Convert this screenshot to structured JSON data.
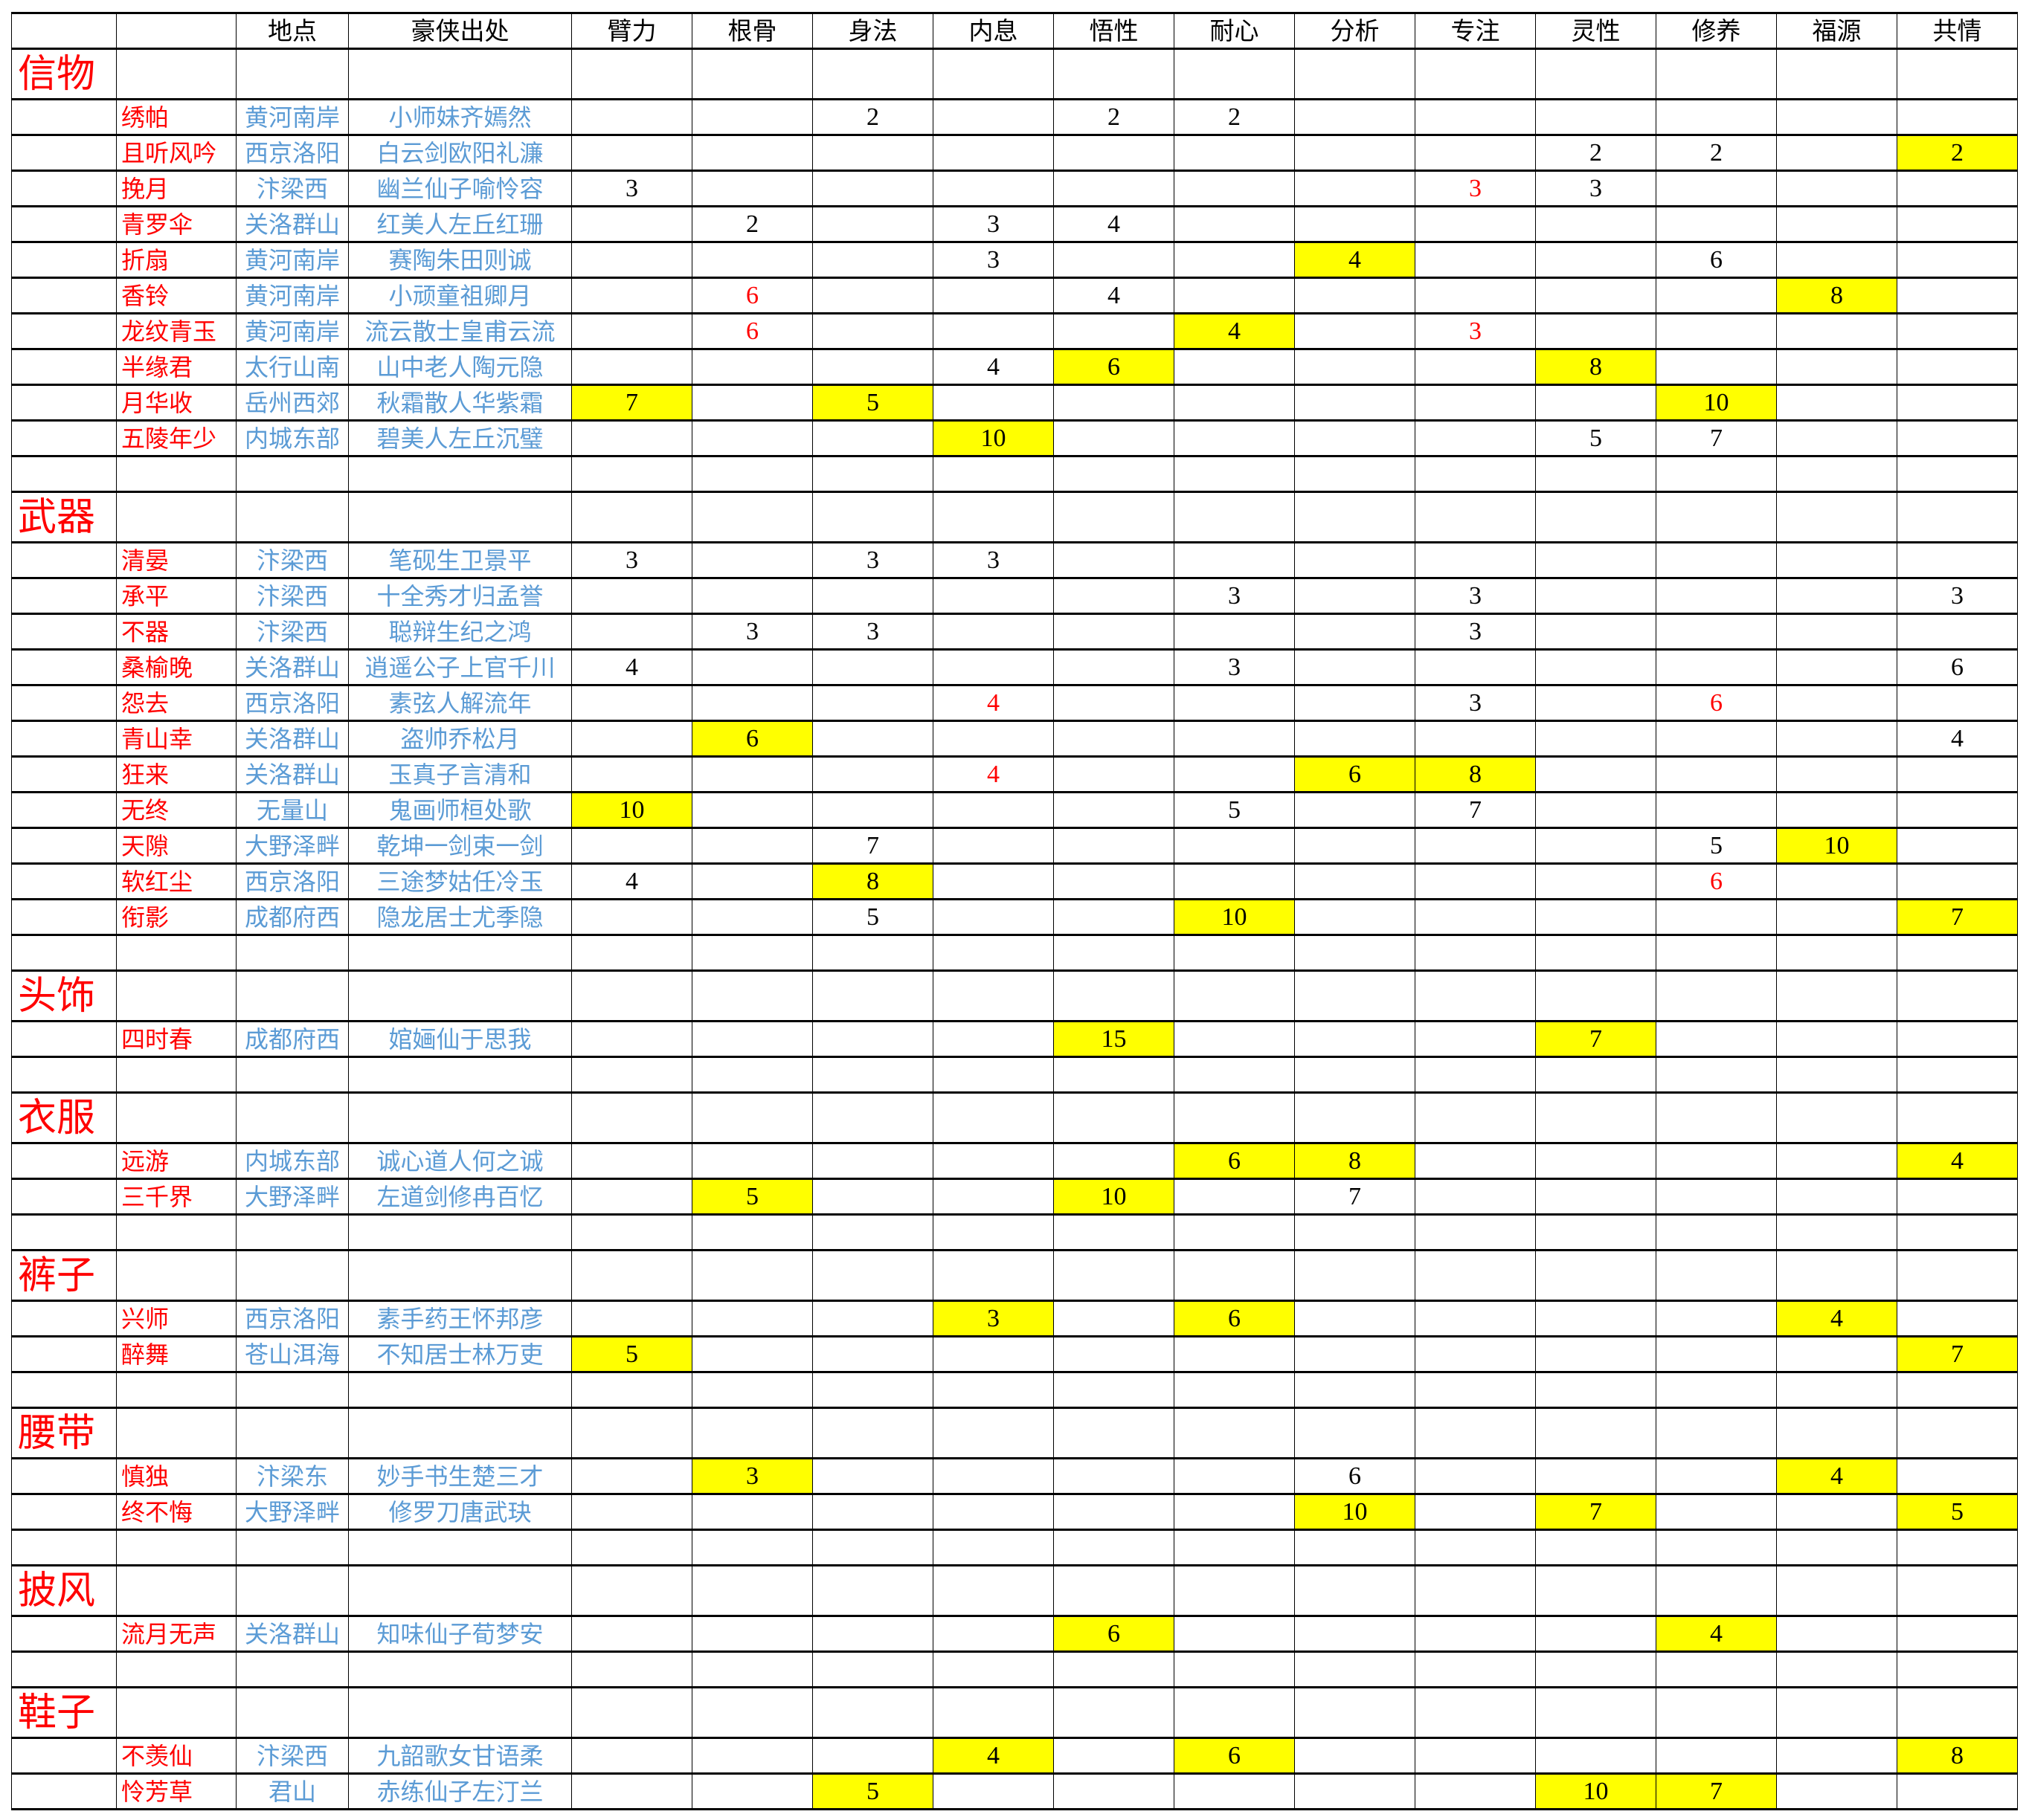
{
  "colors": {
    "item_name": "#ff0000",
    "location": "#5b9bd5",
    "highlight": "#ffff00",
    "red_value": "#ff0000"
  },
  "headers": [
    "",
    "",
    "地点",
    "豪侠出处",
    "臂力",
    "根骨",
    "身法",
    "内息",
    "悟性",
    "耐心",
    "分析",
    "专注",
    "灵性",
    "修养",
    "福源",
    "共情"
  ],
  "sections": [
    {
      "category": "信物",
      "items": [
        {
          "name": "绣帕",
          "location": "黄河南岸",
          "source": "小师妹齐嫣然",
          "stats": {
            "身法": "2",
            "悟性": "2",
            "耐心": "2"
          },
          "highlighted": [],
          "red": []
        },
        {
          "name": "且听风吟",
          "location": "西京洛阳",
          "source": "白云剑欧阳礼濂",
          "stats": {
            "灵性": "2",
            "修养": "2",
            "共情": "2"
          },
          "highlighted": [
            "共情"
          ],
          "red": []
        },
        {
          "name": "挽月",
          "location": "汴梁西",
          "source": "幽兰仙子喻怜容",
          "stats": {
            "臂力": "3",
            "专注": "3",
            "灵性": "3"
          },
          "highlighted": [],
          "red": [
            "专注"
          ]
        },
        {
          "name": "青罗伞",
          "location": "关洛群山",
          "source": "红美人左丘红珊",
          "stats": {
            "根骨": "2",
            "内息": "3",
            "悟性": "4"
          },
          "highlighted": [],
          "red": []
        },
        {
          "name": "折扇",
          "location": "黄河南岸",
          "source": "赛陶朱田则诚",
          "stats": {
            "内息": "3",
            "分析": "4",
            "修养": "6"
          },
          "highlighted": [
            "分析"
          ],
          "red": []
        },
        {
          "name": "香铃",
          "location": "黄河南岸",
          "source": "小顽童祖卿月",
          "stats": {
            "根骨": "6",
            "悟性": "4",
            "福源": "8"
          },
          "highlighted": [
            "福源"
          ],
          "red": [
            "根骨"
          ]
        },
        {
          "name": "龙纹青玉",
          "location": "黄河南岸",
          "source": "流云散士皇甫云流",
          "stats": {
            "根骨": "6",
            "耐心": "4",
            "专注": "3"
          },
          "highlighted": [
            "耐心"
          ],
          "red": [
            "根骨",
            "专注"
          ]
        },
        {
          "name": "半缘君",
          "location": "太行山南",
          "source": "山中老人陶元隐",
          "stats": {
            "内息": "4",
            "悟性": "6",
            "灵性": "8"
          },
          "highlighted": [
            "悟性",
            "灵性"
          ],
          "red": []
        },
        {
          "name": "月华收",
          "location": "岳州西郊",
          "source": "秋霜散人华紫霜",
          "stats": {
            "臂力": "7",
            "身法": "5",
            "修养": "10"
          },
          "highlighted": [
            "臂力",
            "身法",
            "修养"
          ],
          "red": []
        },
        {
          "name": "五陵年少",
          "location": "内城东部",
          "source": "碧美人左丘沉璧",
          "stats": {
            "内息": "10",
            "灵性": "5",
            "修养": "7"
          },
          "highlighted": [
            "内息"
          ],
          "red": []
        }
      ]
    },
    {
      "category": "武器",
      "items": [
        {
          "name": "清晏",
          "location": "汴梁西",
          "source": "笔砚生卫景平",
          "stats": {
            "臂力": "3",
            "身法": "3",
            "内息": "3"
          },
          "highlighted": [],
          "red": []
        },
        {
          "name": "承平",
          "location": "汴梁西",
          "source": "十全秀才归孟誉",
          "stats": {
            "耐心": "3",
            "专注": "3",
            "共情": "3"
          },
          "highlighted": [],
          "red": []
        },
        {
          "name": "不器",
          "location": "汴梁西",
          "source": "聪辩生纪之鸿",
          "stats": {
            "根骨": "3",
            "身法": "3",
            "专注": "3"
          },
          "highlighted": [],
          "red": []
        },
        {
          "name": "桑榆晚",
          "location": "关洛群山",
          "source": "逍遥公子上官千川",
          "stats": {
            "臂力": "4",
            "耐心": "3",
            "共情": "6"
          },
          "highlighted": [],
          "red": []
        },
        {
          "name": "怨去",
          "location": "西京洛阳",
          "source": "素弦人解流年",
          "stats": {
            "内息": "4",
            "专注": "3",
            "修养": "6"
          },
          "highlighted": [],
          "red": [
            "内息",
            "修养"
          ]
        },
        {
          "name": "青山幸",
          "location": "关洛群山",
          "source": "盗帅乔松月",
          "stats": {
            "根骨": "6",
            "共情": "4"
          },
          "highlighted": [
            "根骨"
          ],
          "red": []
        },
        {
          "name": "狂来",
          "location": "关洛群山",
          "source": "玉真子言清和",
          "stats": {
            "内息": "4",
            "分析": "6",
            "专注": "8"
          },
          "highlighted": [
            "分析",
            "专注"
          ],
          "red": [
            "内息"
          ]
        },
        {
          "name": "无终",
          "location": "无量山",
          "source": "鬼画师桓处歌",
          "stats": {
            "臂力": "10",
            "耐心": "5",
            "专注": "7"
          },
          "highlighted": [
            "臂力"
          ],
          "red": []
        },
        {
          "name": "天隙",
          "location": "大野泽畔",
          "source": "乾坤一剑束一剑",
          "stats": {
            "身法": "7",
            "修养": "5",
            "福源": "10"
          },
          "highlighted": [
            "福源"
          ],
          "red": []
        },
        {
          "name": "软红尘",
          "location": "西京洛阳",
          "source": "三途梦姑任冷玉",
          "stats": {
            "臂力": "4",
            "身法": "8",
            "修养": "6"
          },
          "highlighted": [
            "身法"
          ],
          "red": [
            "修养"
          ]
        },
        {
          "name": "衔影",
          "location": "成都府西",
          "source": "隐龙居士尤季隐",
          "stats": {
            "身法": "5",
            "耐心": "10",
            "共情": "7"
          },
          "highlighted": [
            "耐心",
            "共情"
          ],
          "red": []
        }
      ]
    },
    {
      "category": "头饰",
      "items": [
        {
          "name": "四时春",
          "location": "成都府西",
          "source": "婠婳仙于思我",
          "stats": {
            "悟性": "15",
            "灵性": "7"
          },
          "highlighted": [
            "悟性",
            "灵性"
          ],
          "red": []
        }
      ]
    },
    {
      "category": "衣服",
      "items": [
        {
          "name": "远游",
          "location": "内城东部",
          "source": "诚心道人何之诚",
          "stats": {
            "耐心": "6",
            "分析": "8",
            "共情": "4"
          },
          "highlighted": [
            "耐心",
            "分析",
            "共情"
          ],
          "red": []
        },
        {
          "name": "三千界",
          "location": "大野泽畔",
          "source": "左道剑修冉百忆",
          "stats": {
            "根骨": "5",
            "悟性": "10",
            "分析": "7"
          },
          "highlighted": [
            "根骨",
            "悟性"
          ],
          "red": []
        }
      ]
    },
    {
      "category": "裤子",
      "items": [
        {
          "name": "兴师",
          "location": "西京洛阳",
          "source": "素手药王怀邦彦",
          "stats": {
            "内息": "3",
            "耐心": "6",
            "福源": "4"
          },
          "highlighted": [
            "内息",
            "耐心",
            "福源"
          ],
          "red": []
        },
        {
          "name": "醉舞",
          "location": "苍山洱海",
          "source": "不知居士林万吏",
          "stats": {
            "臂力": "5",
            "共情": "7"
          },
          "highlighted": [
            "臂力",
            "共情"
          ],
          "red": []
        }
      ]
    },
    {
      "category": "腰带",
      "items": [
        {
          "name": "慎独",
          "location": "汴梁东",
          "source": "妙手书生楚三才",
          "stats": {
            "根骨": "3",
            "分析": "6",
            "福源": "4"
          },
          "highlighted": [
            "根骨",
            "福源"
          ],
          "red": []
        },
        {
          "name": "终不悔",
          "location": "大野泽畔",
          "source": "修罗刀唐武玦",
          "stats": {
            "分析": "10",
            "灵性": "7",
            "共情": "5"
          },
          "highlighted": [
            "分析",
            "灵性",
            "共情"
          ],
          "red": []
        }
      ]
    },
    {
      "category": "披风",
      "items": [
        {
          "name": "流月无声",
          "location": "关洛群山",
          "source": "知味仙子荀梦安",
          "stats": {
            "悟性": "6",
            "修养": "4"
          },
          "highlighted": [
            "悟性",
            "修养"
          ],
          "red": []
        }
      ]
    },
    {
      "category": "鞋子",
      "items": [
        {
          "name": "不羡仙",
          "location": "汴梁西",
          "source": "九韶歌女甘语柔",
          "stats": {
            "内息": "4",
            "耐心": "6",
            "共情": "8"
          },
          "highlighted": [
            "内息",
            "耐心",
            "共情"
          ],
          "red": []
        },
        {
          "name": "怜芳草",
          "location": "君山",
          "source": "赤练仙子左汀兰",
          "stats": {
            "身法": "5",
            "灵性": "10",
            "修养": "7"
          },
          "highlighted": [
            "身法",
            "灵性",
            "修养"
          ],
          "red": []
        }
      ]
    }
  ]
}
